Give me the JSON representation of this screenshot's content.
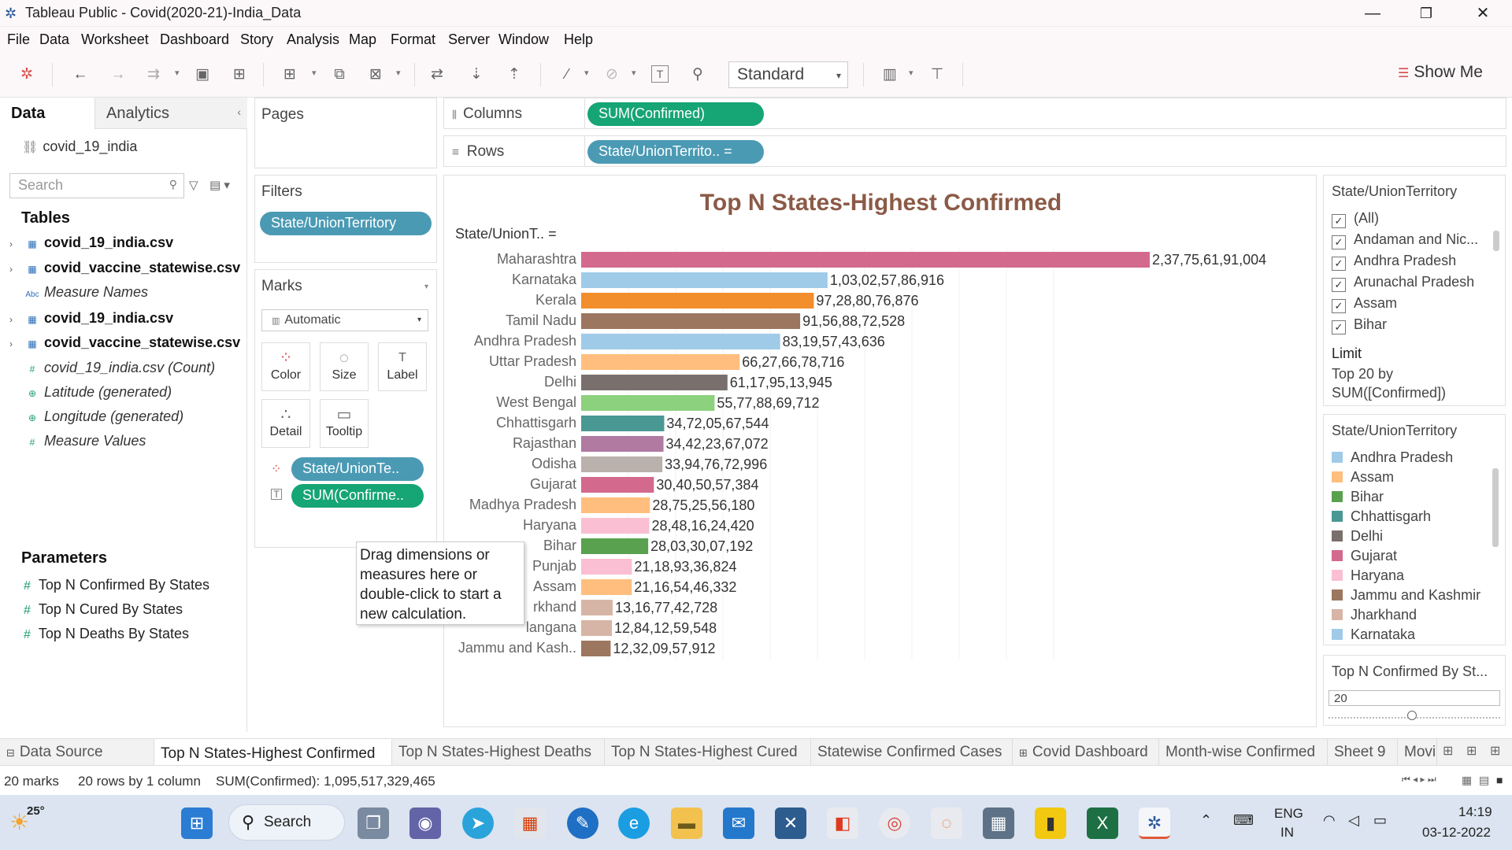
{
  "window": {
    "title": "Tableau Public - Covid(2020-21)-India_Data",
    "minimize": "—",
    "restore": "❐",
    "close": "✕"
  },
  "menu": [
    "File",
    "Data",
    "Worksheet",
    "Dashboard",
    "Story",
    "Analysis",
    "Map",
    "Format",
    "Server",
    "Window",
    "Help"
  ],
  "toolbar": {
    "fit_select": "Standard",
    "show_me": "Show Me"
  },
  "data_pane": {
    "tab_data": "Data",
    "tab_analytics": "Analytics",
    "datasource": "covid_19_india",
    "search_placeholder": "Search",
    "tables_header": "Tables",
    "fields": [
      {
        "icon": "▦",
        "text": "covid_19_india.csv",
        "style": "bold",
        "chev": "›"
      },
      {
        "icon": "▦",
        "text": "covid_vaccine_statewise.csv",
        "style": "bold",
        "chev": "›"
      },
      {
        "icon": "Abc",
        "text": "Measure Names",
        "style": "italic",
        "chev": ""
      },
      {
        "icon": "▦",
        "text": "covid_19_india.csv",
        "style": "bold",
        "chev": "›"
      },
      {
        "icon": "▦",
        "text": "covid_vaccine_statewise.csv",
        "style": "bold",
        "chev": "›"
      },
      {
        "icon": "#",
        "text": "covid_19_india.csv (Count)",
        "style": "italic",
        "chev": ""
      },
      {
        "icon": "⊕",
        "text": "Latitude (generated)",
        "style": "italic",
        "chev": ""
      },
      {
        "icon": "⊕",
        "text": "Longitude (generated)",
        "style": "italic",
        "chev": ""
      },
      {
        "icon": "#",
        "text": "Measure Values",
        "style": "italic",
        "chev": ""
      }
    ],
    "parameters_header": "Parameters",
    "parameters": [
      "Top N Confirmed By States",
      "Top N Cured By States",
      "Top N Deaths By States"
    ]
  },
  "pages": {
    "title": "Pages"
  },
  "filters": {
    "title": "Filters",
    "pill": "State/UnionTerritory"
  },
  "marks": {
    "title": "Marks",
    "type": "Automatic",
    "buttons": [
      {
        "label": "Color",
        "icon": "⁘"
      },
      {
        "label": "Size",
        "icon": "◌"
      },
      {
        "label": "Label",
        "icon": "T"
      },
      {
        "label": "Detail",
        "icon": "∴"
      },
      {
        "label": "Tooltip",
        "icon": "▭"
      }
    ],
    "pill_color": "State/UnionTe..",
    "pill_label": "SUM(Confirme.."
  },
  "shelves": {
    "columns_label": "Columns",
    "columns_pill": "SUM(Confirmed)",
    "rows_label": "Rows",
    "rows_pill": "State/UnionTerrito.. ="
  },
  "chart": {
    "title": "Top N States-Highest Confirmed",
    "row_header": "State/UnionT.. ="
  },
  "chart_data": {
    "type": "bar",
    "orientation": "horizontal",
    "title": "Top N States-Highest Confirmed",
    "categories": [
      "Maharashtra",
      "Karnataka",
      "Kerala",
      "Tamil Nadu",
      "Andhra Pradesh",
      "Uttar Pradesh",
      "Delhi",
      "West Bengal",
      "Chhattisgarh",
      "Rajasthan",
      "Odisha",
      "Gujarat",
      "Madhya Pradesh",
      "Haryana",
      "Bihar",
      "Punjab",
      "Assam",
      "Jharkhand",
      "Telangana",
      "Jammu and Kash.."
    ],
    "category_labels": [
      "Maharashtra",
      "Karnataka",
      "Kerala",
      "Tamil Nadu",
      "Andhra Pradesh",
      "Uttar Pradesh",
      "Delhi",
      "West Bengal",
      "Chhattisgarh",
      "Rajasthan",
      "Odisha",
      "Gujarat",
      "Madhya Pradesh",
      "Haryana",
      "Bihar",
      "Punjab",
      "Assam",
      "rkhand",
      "langana",
      "Jammu and Kash.."
    ],
    "values": [
      237756191004,
      103025786916,
      97288076876,
      91568872528,
      83195743636,
      66276678716,
      61179513945,
      55778869712,
      34720567544,
      34422367072,
      33947672996,
      30405057384,
      28752556180,
      28481624420,
      28033007192,
      21189336824,
      21165446332,
      13167742728,
      12841259548,
      12320957912
    ],
    "value_labels": [
      "2,37,75,61,91,004",
      "1,03,02,57,86,916",
      "97,28,80,76,876",
      "91,56,88,72,528",
      "83,19,57,43,636",
      "66,27,66,78,716",
      "61,17,95,13,945",
      "55,77,88,69,712",
      "34,72,05,67,544",
      "34,42,23,67,072",
      "33,94,76,72,996",
      "30,40,50,57,384",
      "28,75,25,56,180",
      "28,48,16,24,420",
      "28,03,30,07,192",
      "21,18,93,36,824",
      "21,16,54,46,332",
      "13,16,77,42,728",
      "12,84,12,59,548",
      "12,32,09,57,912"
    ],
    "colors": [
      "#d4698e",
      "#a0cbe8",
      "#f28e2b",
      "#9d7660",
      "#a0cbe8",
      "#ffbe7d",
      "#79706e",
      "#8cd17d",
      "#499894",
      "#b07aa1",
      "#bab0ac",
      "#d4698e",
      "#ffbe7d",
      "#fabfd2",
      "#59a14f",
      "#fabfd2",
      "#ffbe7d",
      "#d7b5a6",
      "#d7b5a6",
      "#9d7660"
    ],
    "xlim": [
      0,
      300000000000
    ],
    "grid": true
  },
  "drag_tip": "Drag dimensions or measures here or double-click to start a new calculation.",
  "filter_card": {
    "title": "State/UnionTerritory",
    "items": [
      "(All)",
      "Andaman and Nic...",
      "Andhra Pradesh",
      "Arunachal Pradesh",
      "Assam",
      "Bihar"
    ],
    "checkmark": "✓",
    "limit_label": "Limit",
    "limit_line1": "Top 20 by",
    "limit_line2": "SUM([Confirmed])"
  },
  "legend_card": {
    "title": "State/UnionTerritory",
    "items": [
      {
        "name": "Andhra Pradesh",
        "color": "#a0cbe8"
      },
      {
        "name": "Assam",
        "color": "#ffbe7d"
      },
      {
        "name": "Bihar",
        "color": "#59a14f"
      },
      {
        "name": "Chhattisgarh",
        "color": "#499894"
      },
      {
        "name": "Delhi",
        "color": "#79706e"
      },
      {
        "name": "Gujarat",
        "color": "#d4698e"
      },
      {
        "name": "Haryana",
        "color": "#fabfd2"
      },
      {
        "name": "Jammu and Kashmir",
        "color": "#9d7660"
      },
      {
        "name": "Jharkhand",
        "color": "#d7b5a6"
      },
      {
        "name": "Karnataka",
        "color": "#a0cbe8"
      }
    ]
  },
  "param_card": {
    "title": "Top N Confirmed By St...",
    "value": "20"
  },
  "sheet_tabs": [
    {
      "label": "Data Source",
      "icon": "⊟",
      "active": false
    },
    {
      "label": "Top N States-Highest Confirmed",
      "icon": "",
      "active": true
    },
    {
      "label": "Top N States-Highest Deaths",
      "icon": "",
      "active": false
    },
    {
      "label": "Top N States-Highest Cured",
      "icon": "",
      "active": false
    },
    {
      "label": "Statewise Confirmed Cases",
      "icon": "",
      "active": false
    },
    {
      "label": "Covid Dashboard",
      "icon": "⊞",
      "active": false
    },
    {
      "label": "Month-wise Confirmed",
      "icon": "",
      "active": false
    },
    {
      "label": "Sheet 9",
      "icon": "",
      "active": false
    },
    {
      "label": "Movi",
      "icon": "",
      "active": false
    }
  ],
  "status": {
    "marks": "20 marks",
    "rows": "20 rows by 1 column",
    "sum": "SUM(Confirmed): 1,095,517,329,465"
  },
  "taskbar": {
    "weather": "25°",
    "search": "Search",
    "lang1": "ENG",
    "lang2": "IN",
    "time": "14:19",
    "date": "03-12-2022"
  }
}
